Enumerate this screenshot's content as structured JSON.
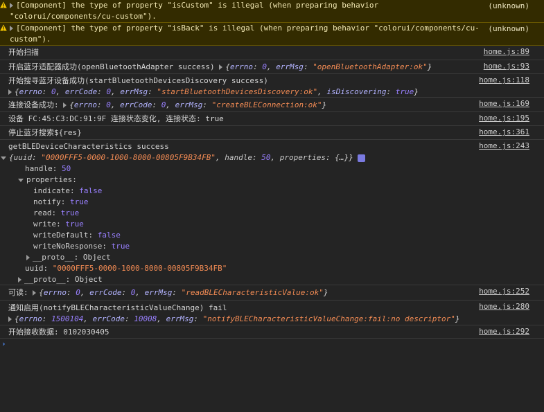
{
  "warnings": [
    {
      "line1": "[Component] the type of property \"isCustom\" is illegal (when preparing behavior",
      "line2": "\"colorui/components/cu-custom\").",
      "source": "(unknown)"
    },
    {
      "line1": "[Component] the type of property \"isBack\" is illegal (when preparing behavior \"colorui/components/cu-",
      "line2": "custom\").",
      "source": "(unknown)"
    }
  ],
  "logs": {
    "scan_start": {
      "text": "开始扫描",
      "source": "home.js:89"
    },
    "adapter": {
      "text": "开启蓝牙适配器成功(openBluetoothAdapter success) ",
      "obj_open": "{",
      "errno_key": "errno",
      "errno_val": "0",
      "errmsg_key": "errMsg",
      "errmsg_val": "\"openBluetoothAdapter:ok\"",
      "obj_close": "}",
      "source": "home.js:93"
    },
    "discovery": {
      "text": "开始搜寻蓝牙设备成功(startBluetoothDevicesDiscovery success)",
      "errno_key": "errno",
      "errno_val": "0",
      "errcode_key": "errCode",
      "errcode_val": "0",
      "errmsg_key": "errMsg",
      "errmsg_val": "\"startBluetoothDevicesDiscovery:ok\"",
      "disc_key": "isDiscovering",
      "disc_val": "true",
      "source": "home.js:118"
    },
    "connect": {
      "text": "连接设备成功: ",
      "errno_key": "errno",
      "errno_val": "0",
      "errcode_key": "errCode",
      "errcode_val": "0",
      "errmsg_key": "errMsg",
      "errmsg_val": "\"createBLEConnection:ok\"",
      "source": "home.js:169"
    },
    "state_change": {
      "text": "设备 FC:45:C3:DC:91:9F 连接状态变化, 连接状态: true",
      "source": "home.js:195"
    },
    "stop_search": {
      "text": "停止蓝牙搜索${res}",
      "source": "home.js:361"
    },
    "characteristics": {
      "text": "getBLEDeviceCharacteristics success",
      "source": "home.js:243",
      "summary_uuid_key": "uuid",
      "summary_uuid_val": "\"0000FFF5-0000-1000-8000-00805F9B34FB\"",
      "summary_handle_key": "handle",
      "summary_handle_val": "50",
      "summary_props_key": "properties",
      "summary_props_val": "{…}",
      "handle_key": "handle",
      "handle_val": "50",
      "properties_key": "properties",
      "props": [
        {
          "key": "indicate",
          "val": "false"
        },
        {
          "key": "notify",
          "val": "true"
        },
        {
          "key": "read",
          "val": "true"
        },
        {
          "key": "write",
          "val": "true"
        },
        {
          "key": "writeDefault",
          "val": "false"
        },
        {
          "key": "writeNoResponse",
          "val": "true"
        }
      ],
      "proto_inner": "__proto__",
      "proto_inner_val": "Object",
      "uuid_key": "uuid",
      "uuid_val": "\"0000FFF5-0000-1000-8000-00805F9B34FB\"",
      "proto_outer": "__proto__",
      "proto_outer_val": "Object"
    },
    "readable": {
      "text": "可读: ",
      "errno_key": "errno",
      "errno_val": "0",
      "errcode_key": "errCode",
      "errcode_val": "0",
      "errmsg_key": "errMsg",
      "errmsg_val": "\"readBLECharacteristicValue:ok\"",
      "source": "home.js:252"
    },
    "notify_fail": {
      "text": "通知启用(notifyBLECharacteristicValueChange) fail",
      "errno_key": "errno",
      "errno_val": "1500104",
      "errcode_key": "errCode",
      "errcode_val": "10008",
      "errmsg_key": "errMsg",
      "errmsg_val": "\"notifyBLECharacteristicValueChange:fail:no descriptor\"",
      "source": "home.js:280"
    },
    "receive": {
      "text": "开始接收数据: 0102030405",
      "source": "home.js:292"
    }
  },
  "prompt_symbol": "›"
}
